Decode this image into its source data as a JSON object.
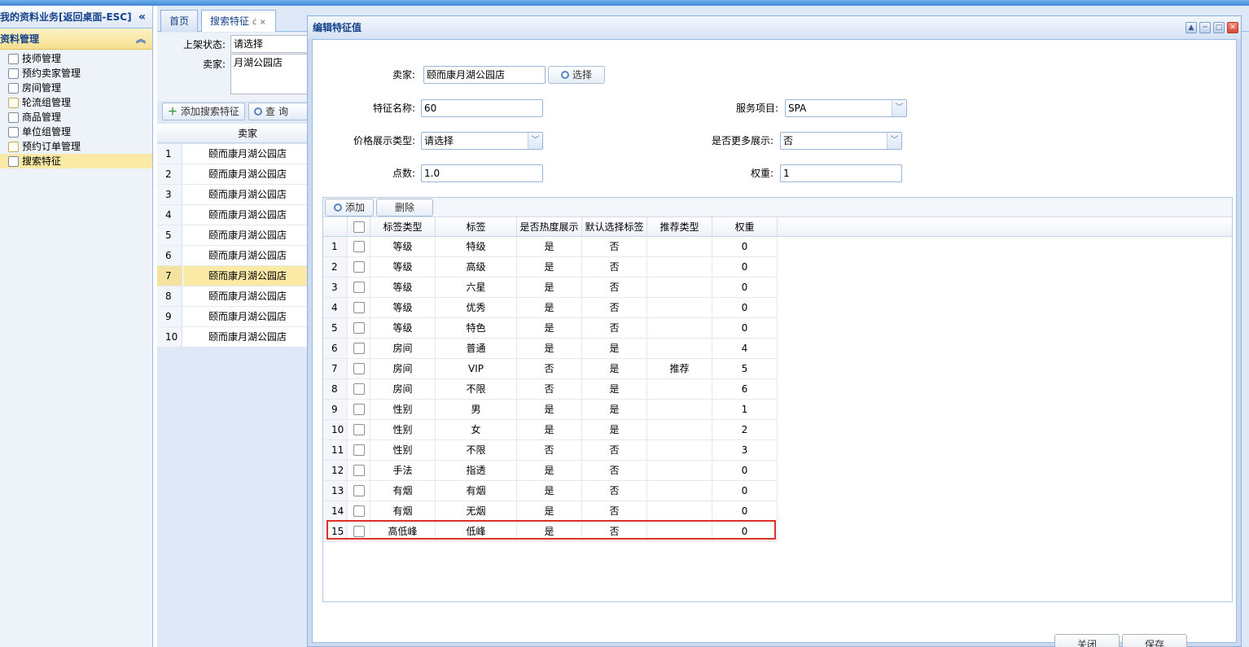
{
  "left_panel": {
    "title": "我的资料业务[返回桌面-ESC]",
    "section": "资料管理",
    "items": [
      {
        "label": "技师管理",
        "icon": "user-icon"
      },
      {
        "label": "预约卖家管理",
        "icon": "user-icon"
      },
      {
        "label": "房间管理",
        "icon": "user-icon"
      },
      {
        "label": "轮流组管理",
        "icon": "doc-icon"
      },
      {
        "label": "商品管理",
        "icon": "user-icon"
      },
      {
        "label": "单位组管理",
        "icon": "user-icon"
      },
      {
        "label": "预约订单管理",
        "icon": "doc-icon"
      },
      {
        "label": "搜索特征",
        "icon": "user-icon",
        "selected": true
      }
    ]
  },
  "tabs": {
    "home": "首页",
    "current": "搜索特征",
    "current_icons": "ċ ×"
  },
  "bg_filter": {
    "status_label": "上架状态:",
    "status_value": "请选择",
    "seller_label": "卖家:",
    "seller_value": "月湖公园店",
    "add_button": "添加搜索特征",
    "query_button": "查 询",
    "column_header": "卖家",
    "rows": [
      {
        "n": "1",
        "seller": "颐而康月湖公园店"
      },
      {
        "n": "2",
        "seller": "颐而康月湖公园店"
      },
      {
        "n": "3",
        "seller": "颐而康月湖公园店"
      },
      {
        "n": "4",
        "seller": "颐而康月湖公园店"
      },
      {
        "n": "5",
        "seller": "颐而康月湖公园店"
      },
      {
        "n": "6",
        "seller": "颐而康月湖公园店"
      },
      {
        "n": "7",
        "seller": "颐而康月湖公园店"
      },
      {
        "n": "8",
        "seller": "颐而康月湖公园店"
      },
      {
        "n": "9",
        "seller": "颐而康月湖公园店"
      },
      {
        "n": "10",
        "seller": "颐而康月湖公园店"
      }
    ],
    "selected_row": 7
  },
  "dialog": {
    "title": "编辑特征值",
    "seller_label": "卖家:",
    "seller_value": "颐而康月湖公园店",
    "select_button": "选择",
    "feature_name_label": "特征名称:",
    "feature_name_value": "60",
    "service_label": "服务项目:",
    "service_value": "SPA",
    "price_type_label": "价格展示类型:",
    "price_type_value": "请选择",
    "more_label": "是否更多展示:",
    "more_value": "否",
    "points_label": "点数:",
    "points_value": "1.0",
    "weight_label": "权重:",
    "weight_value": "1",
    "add_button": "添加",
    "delete_button": "删除",
    "columns": [
      "标签类型",
      "标签",
      "是否热度展示",
      "默认选择标签",
      "推荐类型",
      "权重"
    ],
    "rows": [
      {
        "n": "1",
        "type": "等级",
        "tag": "特级",
        "hot": "是",
        "default": "否",
        "rec": "",
        "weight": "0"
      },
      {
        "n": "2",
        "type": "等级",
        "tag": "高级",
        "hot": "是",
        "default": "否",
        "rec": "",
        "weight": "0"
      },
      {
        "n": "3",
        "type": "等级",
        "tag": "六星",
        "hot": "是",
        "default": "否",
        "rec": "",
        "weight": "0"
      },
      {
        "n": "4",
        "type": "等级",
        "tag": "优秀",
        "hot": "是",
        "default": "否",
        "rec": "",
        "weight": "0"
      },
      {
        "n": "5",
        "type": "等级",
        "tag": "特色",
        "hot": "是",
        "default": "否",
        "rec": "",
        "weight": "0"
      },
      {
        "n": "6",
        "type": "房间",
        "tag": "普通",
        "hot": "是",
        "default": "是",
        "rec": "",
        "weight": "4"
      },
      {
        "n": "7",
        "type": "房间",
        "tag": "VIP",
        "hot": "否",
        "default": "是",
        "rec": "推荐",
        "weight": "5"
      },
      {
        "n": "8",
        "type": "房间",
        "tag": "不限",
        "hot": "否",
        "default": "是",
        "rec": "",
        "weight": "6"
      },
      {
        "n": "9",
        "type": "性别",
        "tag": "男",
        "hot": "是",
        "default": "是",
        "rec": "",
        "weight": "1"
      },
      {
        "n": "10",
        "type": "性别",
        "tag": "女",
        "hot": "是",
        "default": "是",
        "rec": "",
        "weight": "2"
      },
      {
        "n": "11",
        "type": "性别",
        "tag": "不限",
        "hot": "否",
        "default": "否",
        "rec": "",
        "weight": "3"
      },
      {
        "n": "12",
        "type": "手法",
        "tag": "指透",
        "hot": "是",
        "default": "否",
        "rec": "",
        "weight": "0"
      },
      {
        "n": "13",
        "type": "有烟",
        "tag": "有烟",
        "hot": "是",
        "default": "否",
        "rec": "",
        "weight": "0"
      },
      {
        "n": "14",
        "type": "有烟",
        "tag": "无烟",
        "hot": "是",
        "default": "否",
        "rec": "",
        "weight": "0"
      },
      {
        "n": "15",
        "type": "高低峰",
        "tag": "低峰",
        "hot": "是",
        "default": "否",
        "rec": "",
        "weight": "0"
      }
    ],
    "highlighted_row": 15,
    "close_button": "关闭",
    "save_button": "保存"
  },
  "colors": {
    "accent": "#15428b",
    "selection": "#fbe9a6",
    "highlight_border": "#e0302a"
  }
}
